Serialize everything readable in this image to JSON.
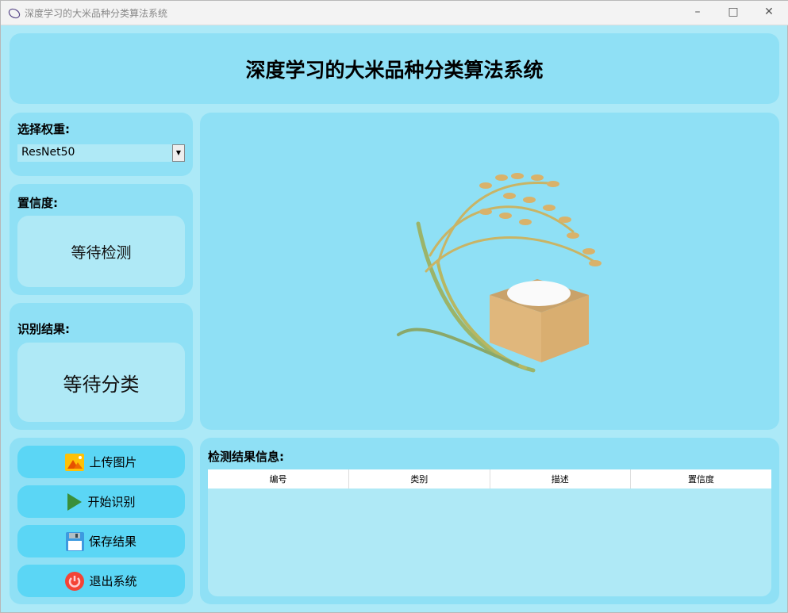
{
  "window": {
    "title": "深度学习的大米品种分类算法系统"
  },
  "header": {
    "title": "深度学习的大米品种分类算法系统"
  },
  "weight": {
    "label": "选择权重:",
    "selected": "ResNet50"
  },
  "confidence": {
    "label": "置信度:",
    "value": "等待检测"
  },
  "result": {
    "label": "识别结果:",
    "value": "等待分类"
  },
  "buttons": [
    {
      "label": "上传图片",
      "icon": "image-icon"
    },
    {
      "label": "开始识别",
      "icon": "play-icon"
    },
    {
      "label": "保存结果",
      "icon": "save-icon"
    },
    {
      "label": "退出系统",
      "icon": "power-icon"
    }
  ],
  "table": {
    "title": "检测结果信息:",
    "columns": [
      "编号",
      "类别",
      "描述",
      "置信度"
    ],
    "rows": []
  }
}
